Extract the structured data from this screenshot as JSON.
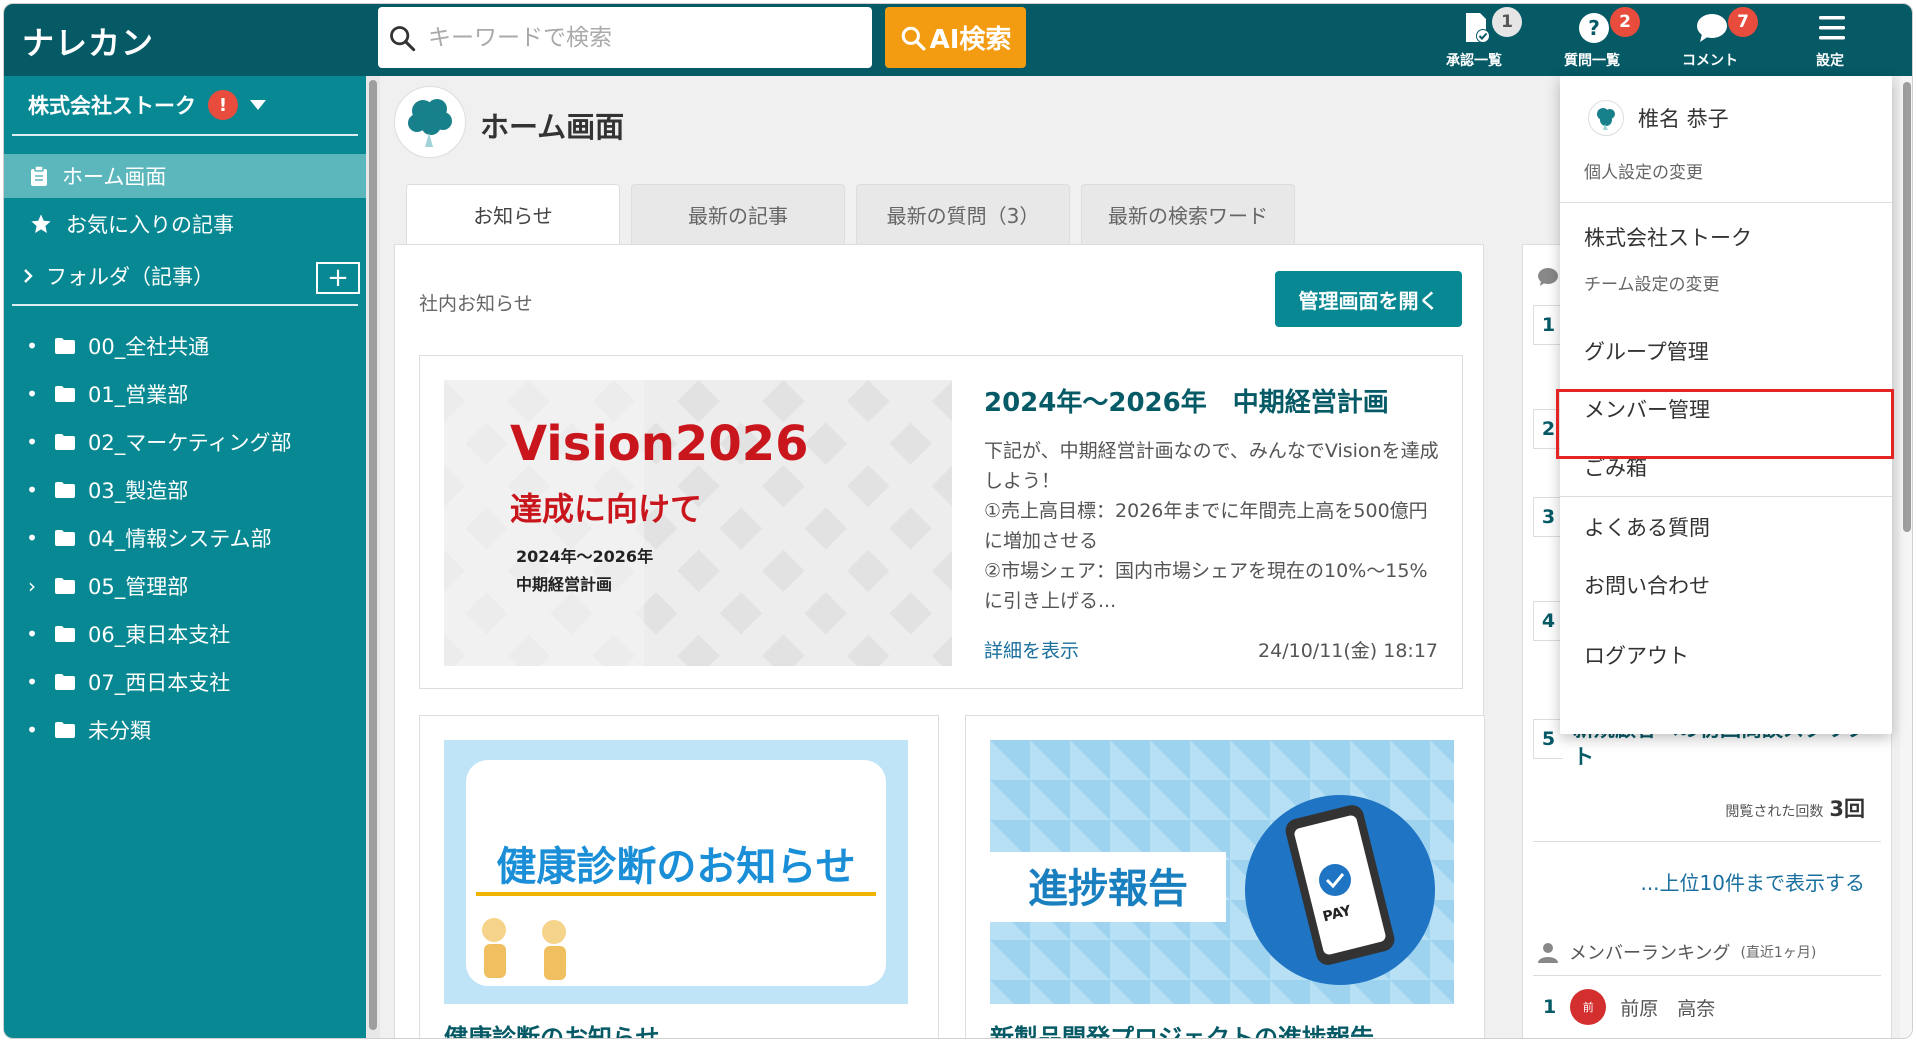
{
  "header": {
    "logo": "ナレカン",
    "search_placeholder": "キーワードで検索",
    "ai_search_label": "AI検索",
    "icons": [
      {
        "name": "approval-list-icon",
        "label": "承認一覧",
        "badge": "1",
        "badge_color": "#e5e5e5"
      },
      {
        "name": "question-list-icon",
        "label": "質問一覧",
        "badge": "2",
        "badge_color": "#e74c3c"
      },
      {
        "name": "comment-icon",
        "label": "コメント",
        "badge": "7",
        "badge_color": "#e74c3c"
      },
      {
        "name": "menu-icon",
        "label": "設定",
        "badge": ""
      }
    ]
  },
  "sidebar": {
    "company": "株式会社ストーク",
    "company_alert": "!",
    "nav": [
      {
        "label": "ホーム画面",
        "active": true,
        "icon": "clipboard-icon"
      },
      {
        "label": "お気に入りの記事",
        "active": false,
        "icon": "star-icon"
      }
    ],
    "folder_section": "フォルダ（記事）",
    "add_label": "+",
    "folders": [
      {
        "label": "00_全社共通",
        "marker": "•"
      },
      {
        "label": "01_営業部",
        "marker": "•"
      },
      {
        "label": "02_マーケティング部",
        "marker": "•"
      },
      {
        "label": "03_製造部",
        "marker": "•"
      },
      {
        "label": "04_情報システム部",
        "marker": "•"
      },
      {
        "label": "05_管理部",
        "marker": "›"
      },
      {
        "label": "06_東日本支社",
        "marker": "•"
      },
      {
        "label": "07_西日本支社",
        "marker": "•"
      },
      {
        "label": "未分類",
        "marker": "•"
      }
    ]
  },
  "main": {
    "page_title": "ホーム画面",
    "tabs": [
      {
        "label": "お知らせ",
        "active": true
      },
      {
        "label": "最新の記事",
        "active": false
      },
      {
        "label": "最新の質問（3）",
        "active": false
      },
      {
        "label": "最新の検索ワード",
        "active": false
      }
    ],
    "section_label": "社内お知らせ",
    "admin_button": "管理画面を開く",
    "featured": {
      "image_title": "Vision2026",
      "image_subtitle": "達成に向けて",
      "image_line1": "2024年〜2026年",
      "image_line2": "中期経営計画",
      "title": "2024年〜2026年　中期経営計画",
      "body": "下記が、中期経営計画なので、みんなでVisionを達成しよう！\n①売上高目標：2026年までに年間売上高を500億円に増加させる\n②市場シェア：国内市場シェアを現在の10%〜15%に引き上げる...",
      "link": "詳細を表示",
      "date": "24/10/11(金) 18:17"
    },
    "cards": [
      {
        "image_text": "健康診断のお知らせ",
        "title": "健康診断のお知らせ"
      },
      {
        "image_text": "進捗報告",
        "image_badge": "PAY",
        "title": "新製品開発プロジェクトの進捗報告"
      }
    ]
  },
  "right_panel": {
    "ranks": [
      "1",
      "2",
      "3",
      "4",
      "5"
    ],
    "item5_title": "新規顧客への初回商談スクリプト",
    "item5_count_label": "閲覧された回数",
    "item5_count": "3回",
    "more_link": "...上位10件まで表示する",
    "member_ranking_label": "メンバーランキング",
    "member_ranking_period": "(直近1ヶ月)",
    "member1_rank": "1",
    "member1_avatar": "前",
    "member1_name": "前原　高奈"
  },
  "dropdown": {
    "user_name": "椎名 恭子",
    "personal_settings": "個人設定の変更",
    "team_name": "株式会社ストーク",
    "team_settings": "チーム設定の変更",
    "items": [
      "グループ管理",
      "メンバー管理",
      "ごみ箱",
      "よくある質問",
      "お問い合わせ",
      "ログアウト"
    ],
    "highlight_color": "#e32424"
  },
  "colors": {
    "header": "#055a66",
    "sidebar": "#078893",
    "accent_orange": "#f39c12",
    "badge_red": "#e74c3c"
  }
}
